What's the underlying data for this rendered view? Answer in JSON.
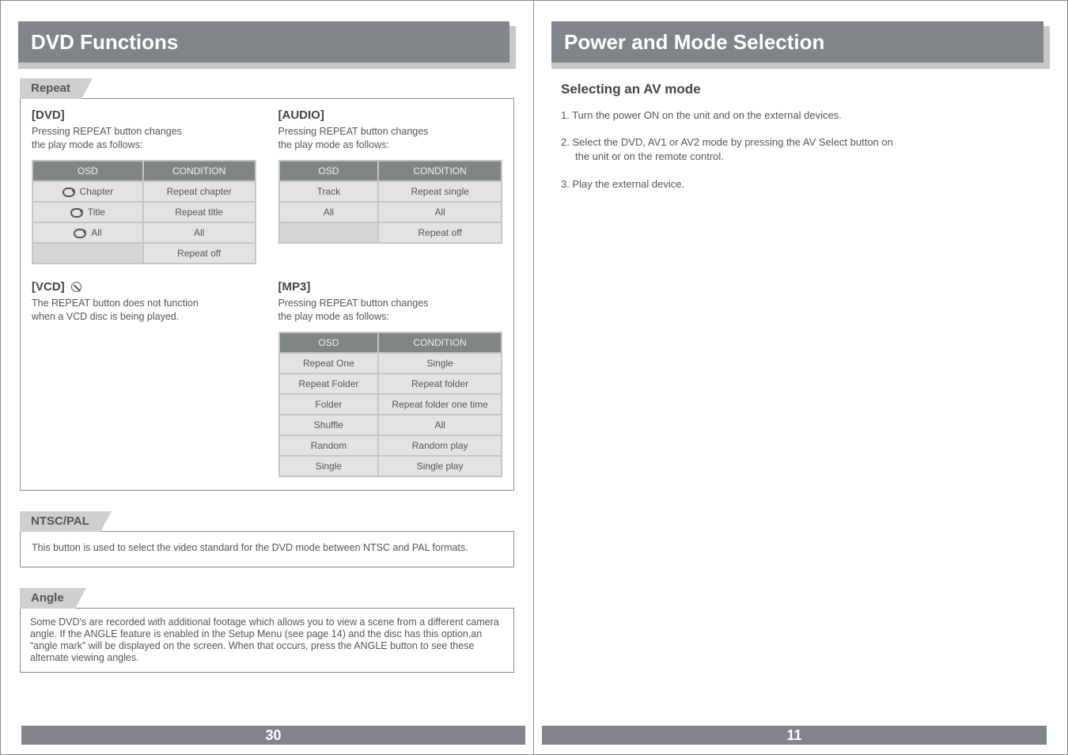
{
  "left": {
    "title": "DVD Functions",
    "pageNumber": "30",
    "repeat": {
      "label": "Repeat",
      "dvd": {
        "heading": "[DVD]",
        "desc1": "Pressing REPEAT button changes",
        "desc2": "the play mode as follows:",
        "osdHeader": "OSD",
        "condHeader": "CONDITION",
        "rows": [
          {
            "osd": "Chapter",
            "cond": "Repeat chapter",
            "icon": true
          },
          {
            "osd": "Title",
            "cond": "Repeat title",
            "icon": true
          },
          {
            "osd": "All",
            "cond": "All",
            "icon": true
          },
          {
            "osd": "",
            "cond": "Repeat off",
            "icon": false,
            "blank": true
          }
        ]
      },
      "audio": {
        "heading": "[AUDIO]",
        "desc1": "Pressing REPEAT button changes",
        "desc2": "the play mode as follows:",
        "osdHeader": "OSD",
        "condHeader": "CONDITION",
        "rows": [
          {
            "osd": "Track",
            "cond": "Repeat single"
          },
          {
            "osd": "All",
            "cond": "All"
          },
          {
            "osd": "",
            "cond": "Repeat off",
            "blank": true
          }
        ]
      },
      "vcd": {
        "heading": "[VCD]",
        "desc1": "The REPEAT button does not function",
        "desc2": "when a VCD disc is being played."
      },
      "mp3": {
        "heading": "[MP3]",
        "desc1": "Pressing REPEAT button changes",
        "desc2": "the play mode as follows:",
        "osdHeader": "OSD",
        "condHeader": "CONDITION",
        "rows": [
          {
            "osd": "Repeat One",
            "cond": "Single"
          },
          {
            "osd": "Repeat Folder",
            "cond": "Repeat folder"
          },
          {
            "osd": "Folder",
            "cond": "Repeat folder one time"
          },
          {
            "osd": "Shuffle",
            "cond": "All"
          },
          {
            "osd": "Random",
            "cond": "Random play"
          },
          {
            "osd": "Single",
            "cond": "Single play"
          }
        ]
      }
    },
    "ntsc": {
      "label": "NTSC/PAL",
      "body": "This button is used to select the video standard for the DVD mode between NTSC and PAL formats."
    },
    "angle": {
      "label": "Angle",
      "body": "Some DVD's are recorded with additional footage which allows you to view a scene from a different camera angle. If the ANGLE feature is enabled in the Setup Menu (see page 14) and the disc has this option,an “angle mark” will be displayed on the screen. When that occurs, press the ANGLE button to see these alternate viewing angles."
    }
  },
  "right": {
    "title": "Power and Mode Selection",
    "pageNumber": "11",
    "heading": "Selecting an AV mode",
    "step1": "1. Turn the power ON on the unit and on the external devices.",
    "step2a": "2. Select the DVD, AV1 or AV2 mode by pressing the AV Select button on",
    "step2b": "the unit or on the remote control.",
    "step3": "3. Play the external device."
  }
}
